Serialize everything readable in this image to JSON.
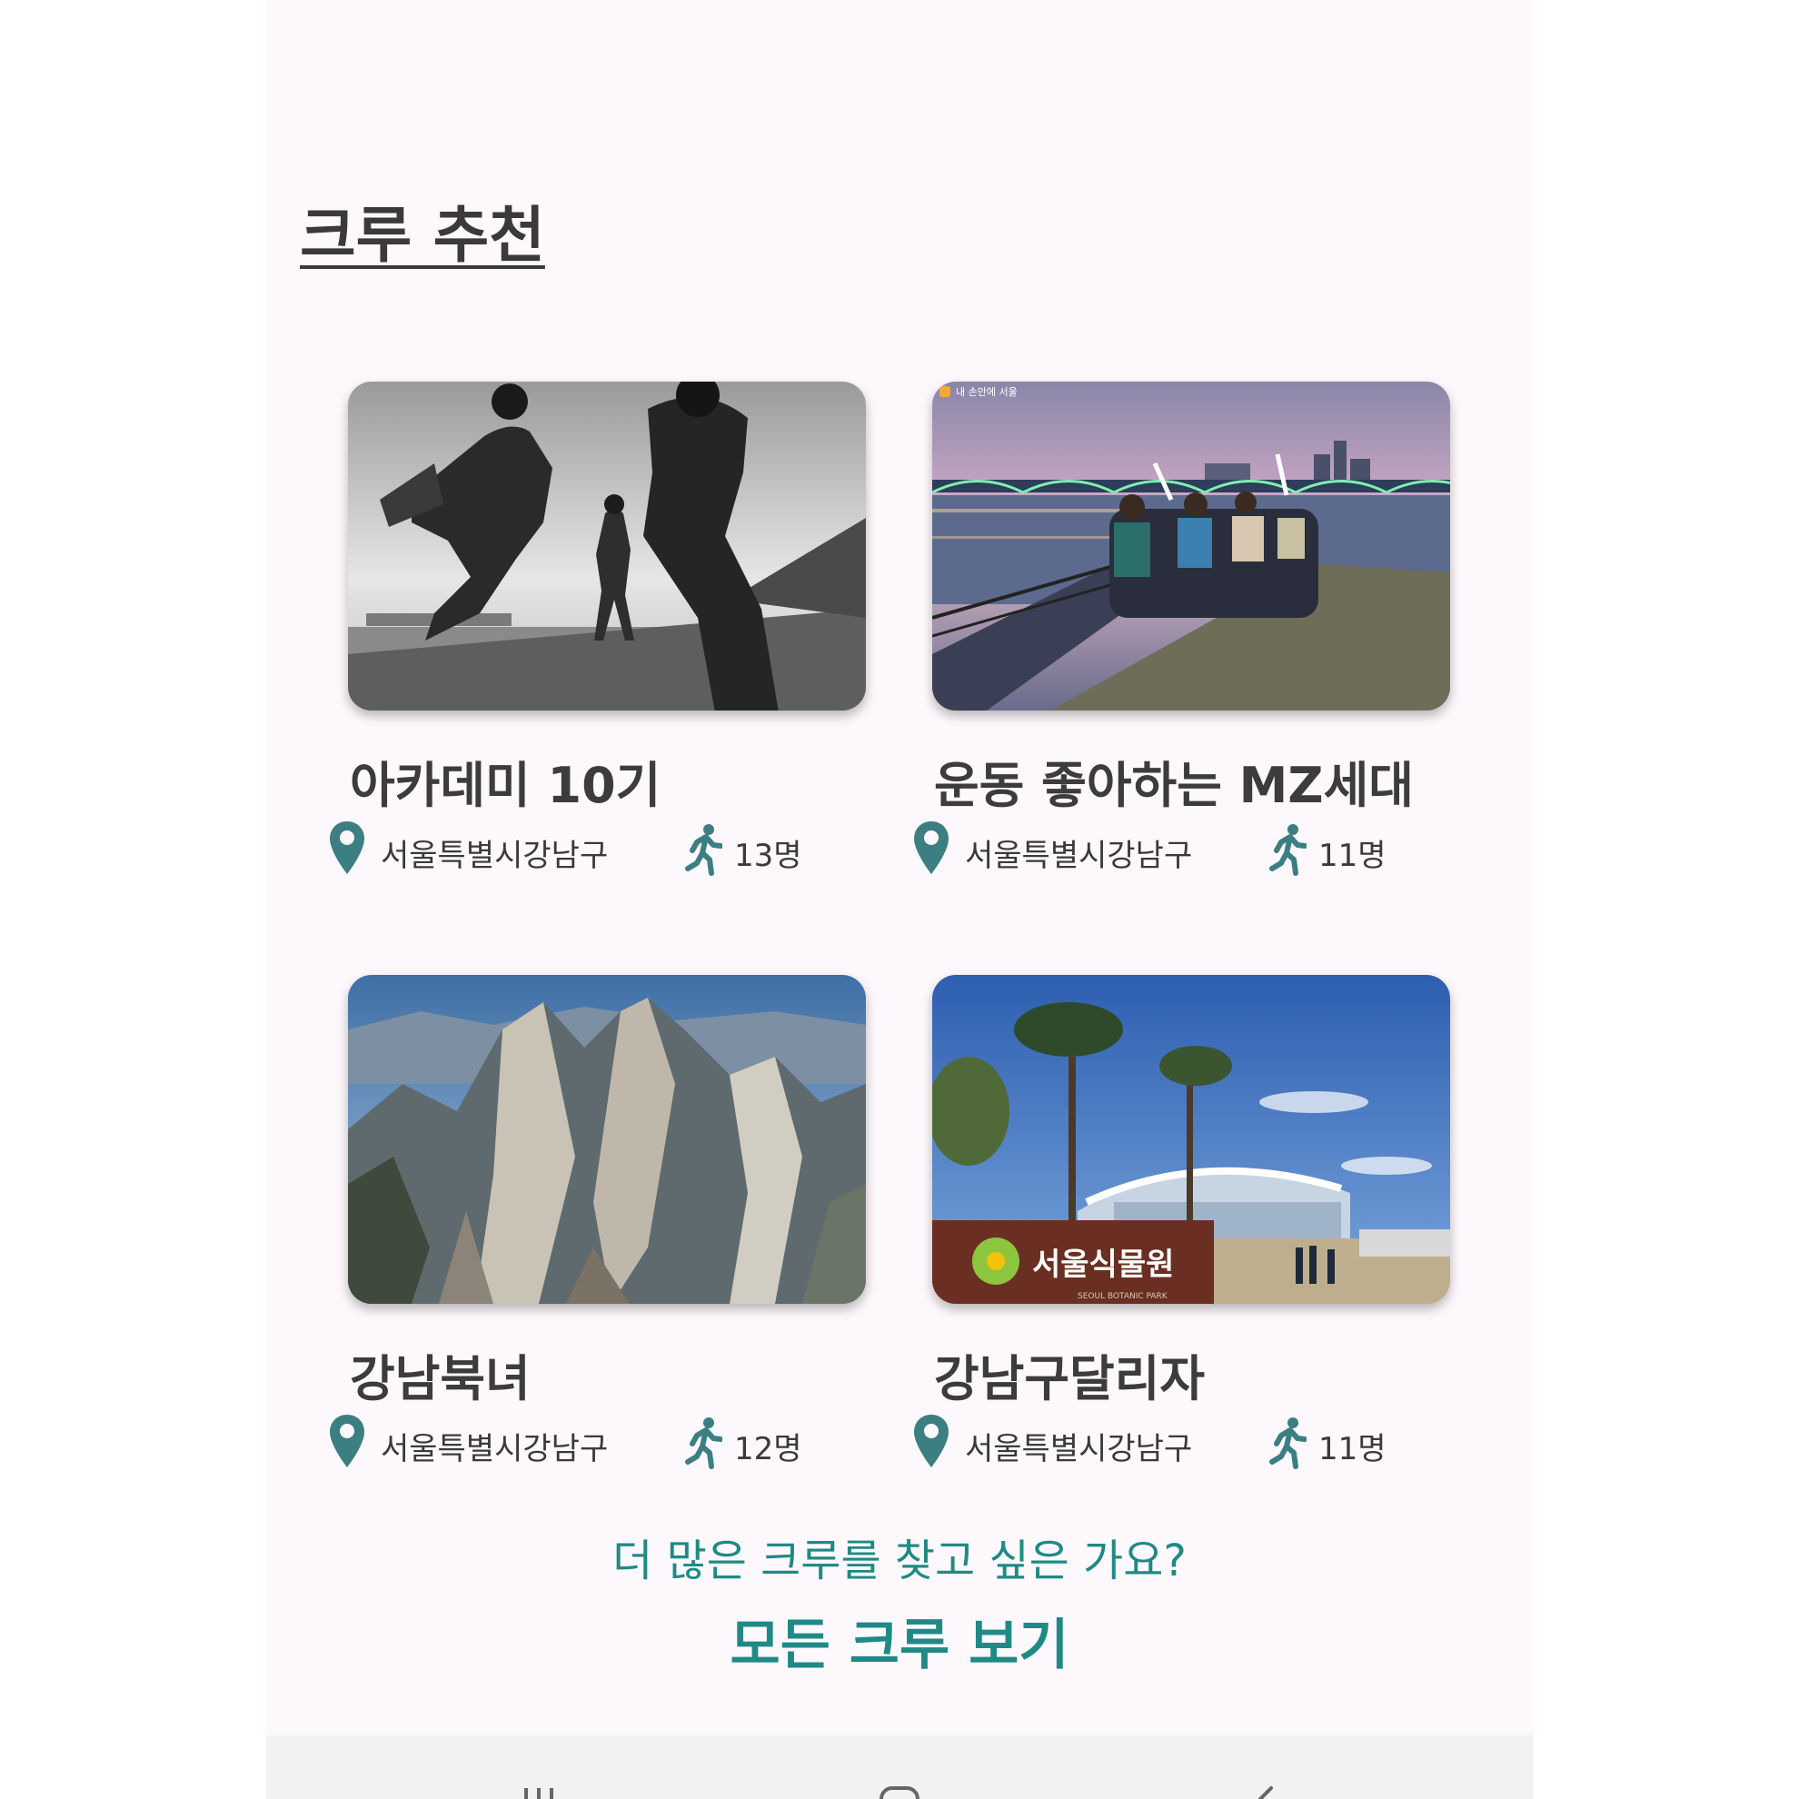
{
  "section": {
    "title": "크루 추천"
  },
  "crews": [
    {
      "name": "아카데미 10기",
      "location": "서울특별시강남구",
      "members": "13명",
      "photo": "runners-bw-photo"
    },
    {
      "name": "운동 좋아하는 MZ세대",
      "location": "서울특별시강남구",
      "members": "11명",
      "photo": "han-river-night-run-photo"
    },
    {
      "name": "강남북녀",
      "location": "서울특별시강남구",
      "members": "12명",
      "photo": "rocky-mountain-photo"
    },
    {
      "name": "강남구달리자",
      "location": "서울특별시강남구",
      "members": "11명",
      "photo": "botanic-park-photo"
    }
  ],
  "photo_text": {
    "watermark": "내 손안에 서울",
    "sign": "서울식물원",
    "sign_sub": "SEOUL BOTANIC PARK"
  },
  "footer": {
    "prompt": "더 많은 크루를 찾고 싶은 가요?",
    "link_label": "모든 크루 보기"
  },
  "navbar": {
    "buttons": [
      "recent-apps-icon",
      "home-icon",
      "back-icon"
    ]
  },
  "colors": {
    "accent": "#1f8a85",
    "icon": "#3c7f82",
    "screen_bg": "#fdf8fc",
    "text": "#3a3a3a",
    "navbar_bg": "#f2f2f2"
  }
}
